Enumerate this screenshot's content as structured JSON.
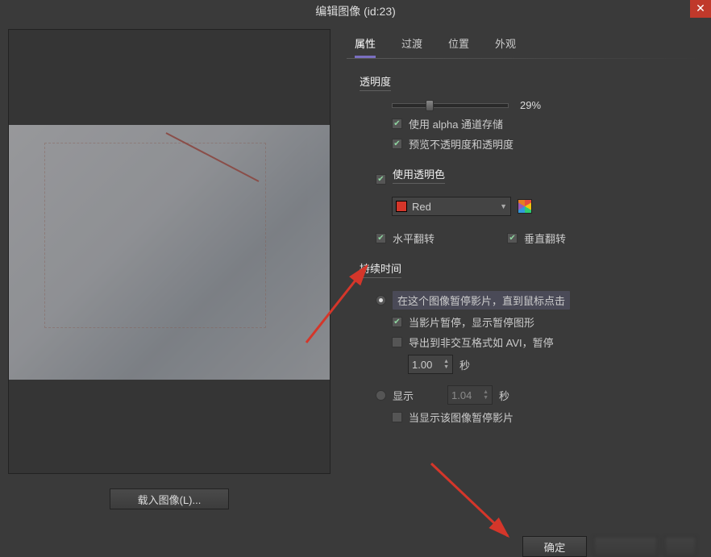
{
  "window": {
    "title": "编辑图像 (id:23)"
  },
  "tabs": [
    "属性",
    "过渡",
    "位置",
    "外观"
  ],
  "opacity": {
    "label": "透明度",
    "value_pct": 29,
    "value_text": "29%",
    "alpha_checkbox": "使用 alpha 通道存储",
    "preview_checkbox": "预览不透明度和透明度"
  },
  "transparent_color": {
    "checkbox_label": "使用透明色",
    "color_name": "Red",
    "color_hex": "#d4362a"
  },
  "flip": {
    "horizontal": "水平翻转",
    "vertical": "垂直翻转"
  },
  "duration": {
    "label": "持续时间",
    "pause_option": "在这个图像暂停影片，直到鼠标点击",
    "pause_show_shape": "当影片暂停，显示暂停图形",
    "export_avi": "导出到非交互格式如 AVI，暂停",
    "export_value": "1.00",
    "show_option": "显示",
    "show_value": "1.04",
    "seconds_unit": "秒",
    "pause_on_show": "当显示该图像暂停影片"
  },
  "buttons": {
    "load_image": "载入图像(L)...",
    "ok": "确定"
  }
}
